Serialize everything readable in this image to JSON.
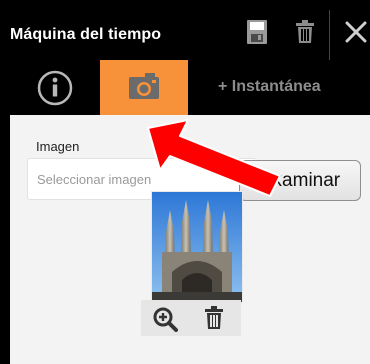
{
  "window": {
    "title": "Máquina del tiempo",
    "icons": {
      "save": "save-icon",
      "delete": "trash-icon",
      "close": "close-icon"
    }
  },
  "tabs": {
    "info_icon": "info-icon",
    "photo_icon": "camera-icon",
    "add_snapshot_label": "+ Instantánea",
    "active_color": "#f7913a"
  },
  "form": {
    "image_label": "Imagen",
    "image_placeholder": "Seleccionar imagen",
    "browse_label": "Examinar"
  },
  "thumbnail": {
    "zoom_icon": "zoom-in-icon",
    "delete_icon": "trash-icon"
  },
  "colors": {
    "background": "#000000",
    "accent": "#f7913a",
    "arrow": "#ff0000",
    "content_bg": "#f3f3f3"
  }
}
